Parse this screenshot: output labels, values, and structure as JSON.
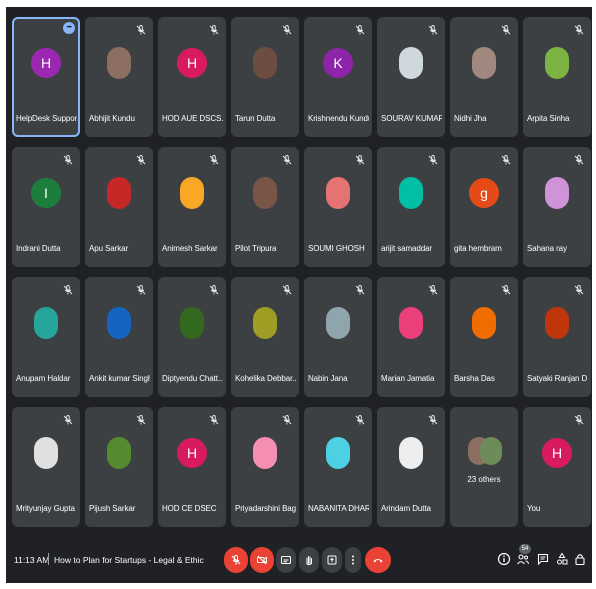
{
  "participants": [
    {
      "name": "HelpDesk Support",
      "initial": "H",
      "color": "#9c27b0",
      "photo": false,
      "active": true,
      "muted": false
    },
    {
      "name": "Abhijit Kundu",
      "initial": "",
      "color": "#8d6e63",
      "photo": true,
      "muted": true
    },
    {
      "name": "HOD AUE DSCS...",
      "initial": "H",
      "color": "#d81b60",
      "photo": false,
      "muted": true
    },
    {
      "name": "Tarun Dutta",
      "initial": "",
      "color": "#6d4c41",
      "photo": true,
      "muted": true
    },
    {
      "name": "Krishnendu Kundu",
      "initial": "K",
      "color": "#8e24aa",
      "photo": false,
      "muted": true
    },
    {
      "name": "SOURAV KUMAR ...",
      "initial": "",
      "color": "#cfd8dc",
      "photo": true,
      "muted": true
    },
    {
      "name": "Nidhi Jha",
      "initial": "",
      "color": "#a1887f",
      "photo": true,
      "muted": true
    },
    {
      "name": "Arpita Sinha",
      "initial": "",
      "color": "#7cb342",
      "photo": true,
      "muted": true
    },
    {
      "name": "Indrani Dutta",
      "initial": "I",
      "color": "#1b7f3b",
      "photo": false,
      "muted": true
    },
    {
      "name": "Apu Sarkar",
      "initial": "",
      "color": "#c62828",
      "photo": true,
      "muted": true
    },
    {
      "name": "Animesh Sarkar",
      "initial": "",
      "color": "#f9a825",
      "photo": true,
      "muted": true
    },
    {
      "name": "Pilot Tripura",
      "initial": "",
      "color": "#795548",
      "photo": true,
      "muted": true
    },
    {
      "name": "SOUMI GHOSH",
      "initial": "",
      "color": "#e57373",
      "photo": true,
      "muted": true
    },
    {
      "name": "arijit samaddar",
      "initial": "",
      "color": "#00bfa5",
      "photo": true,
      "muted": true
    },
    {
      "name": "gita hembram",
      "initial": "g",
      "color": "#e64a19",
      "photo": false,
      "muted": true
    },
    {
      "name": "Sahana ray",
      "initial": "",
      "color": "#ce93d8",
      "photo": true,
      "muted": true
    },
    {
      "name": "Anupam Haldar",
      "initial": "",
      "color": "#26a69a",
      "photo": true,
      "muted": true
    },
    {
      "name": "Ankit kumar Singh",
      "initial": "",
      "color": "#1565c0",
      "photo": true,
      "muted": true
    },
    {
      "name": "Diptyendu Chatt...",
      "initial": "",
      "color": "#33691e",
      "photo": true,
      "muted": true
    },
    {
      "name": "Kohelika Debbar...",
      "initial": "",
      "color": "#9e9d24",
      "photo": true,
      "muted": true
    },
    {
      "name": "Nabin Jana",
      "initial": "",
      "color": "#90a4ae",
      "photo": true,
      "muted": true
    },
    {
      "name": "Marian Jamatia",
      "initial": "",
      "color": "#ec407a",
      "photo": true,
      "muted": true
    },
    {
      "name": "Barsha Das",
      "initial": "",
      "color": "#ef6c00",
      "photo": true,
      "muted": true
    },
    {
      "name": "Satyaki Ranjan D...",
      "initial": "",
      "color": "#bf360c",
      "photo": true,
      "muted": true
    },
    {
      "name": "Mrityunjay Gupta",
      "initial": "",
      "color": "#e0e0e0",
      "photo": true,
      "muted": true
    },
    {
      "name": "Pijush Sarkar",
      "initial": "",
      "color": "#558b2f",
      "photo": true,
      "muted": true
    },
    {
      "name": "HOD CE DSEC",
      "initial": "H",
      "color": "#d81b60",
      "photo": false,
      "muted": true
    },
    {
      "name": "Priyadarshini Bag",
      "initial": "",
      "color": "#f48fb1",
      "photo": true,
      "muted": true
    },
    {
      "name": "NABANITA DHAR",
      "initial": "",
      "color": "#4dd0e1",
      "photo": true,
      "muted": true
    },
    {
      "name": "Arindam Dutta",
      "initial": "",
      "color": "#eeeeee",
      "photo": true,
      "muted": true
    }
  ],
  "others_tile": {
    "label": "23 others"
  },
  "you_tile": {
    "name": "You",
    "initial": "H",
    "color": "#d81b60"
  },
  "bottom_bar": {
    "time": "11:13 AM",
    "meeting_title": "How to Plan for Startups - Legal & Ethical S...",
    "people_count": "54"
  },
  "colors": {
    "background": "#202124",
    "tile": "#3c4043",
    "danger": "#ea4335",
    "accent": "#8ab4f8"
  }
}
